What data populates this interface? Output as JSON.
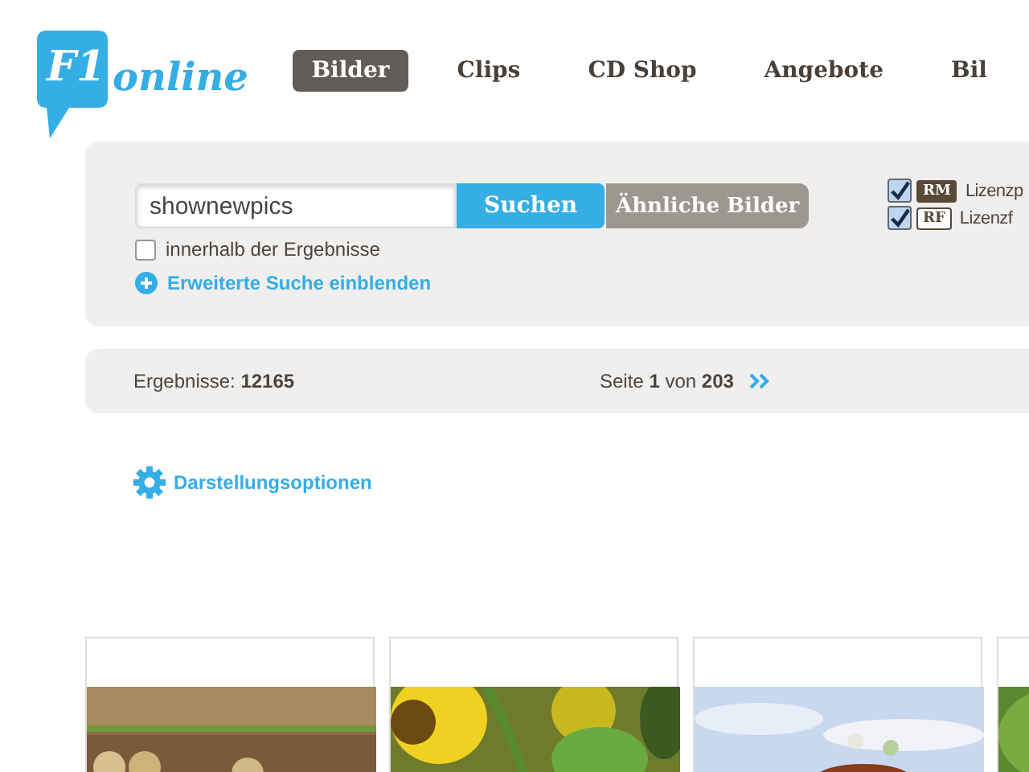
{
  "logo": {
    "mark": "F1",
    "word": "online"
  },
  "nav": [
    {
      "label": "Bilder",
      "selected": true
    },
    {
      "label": "Clips",
      "selected": false
    },
    {
      "label": "CD Shop",
      "selected": false
    },
    {
      "label": "Angebote",
      "selected": false
    },
    {
      "label": "Bil",
      "selected": false
    }
  ],
  "search": {
    "value": "shownewpics",
    "submit": "Suchen",
    "similar": "Ähnliche Bilder",
    "within": {
      "label": "innerhalb der Ergebnisse",
      "checked": false
    },
    "advanced": "Erweiterte Suche einblenden"
  },
  "licenses": [
    {
      "badge": "RM",
      "label": "Lizenzp",
      "checked": true,
      "kind": "dark"
    },
    {
      "badge": "RF",
      "label": "Lizenzf",
      "checked": true,
      "kind": "light"
    }
  ],
  "results": {
    "label": "Ergebnisse:",
    "count": "12165",
    "page_prefix": "Seite",
    "page": "1",
    "page_mid": "von",
    "pages": "203"
  },
  "display_options": "Darstellungsoptionen",
  "thumbnails": [
    {
      "kind": "field"
    },
    {
      "kind": "sunflower"
    },
    {
      "kind": "butterfly"
    },
    {
      "kind": "green"
    }
  ]
}
